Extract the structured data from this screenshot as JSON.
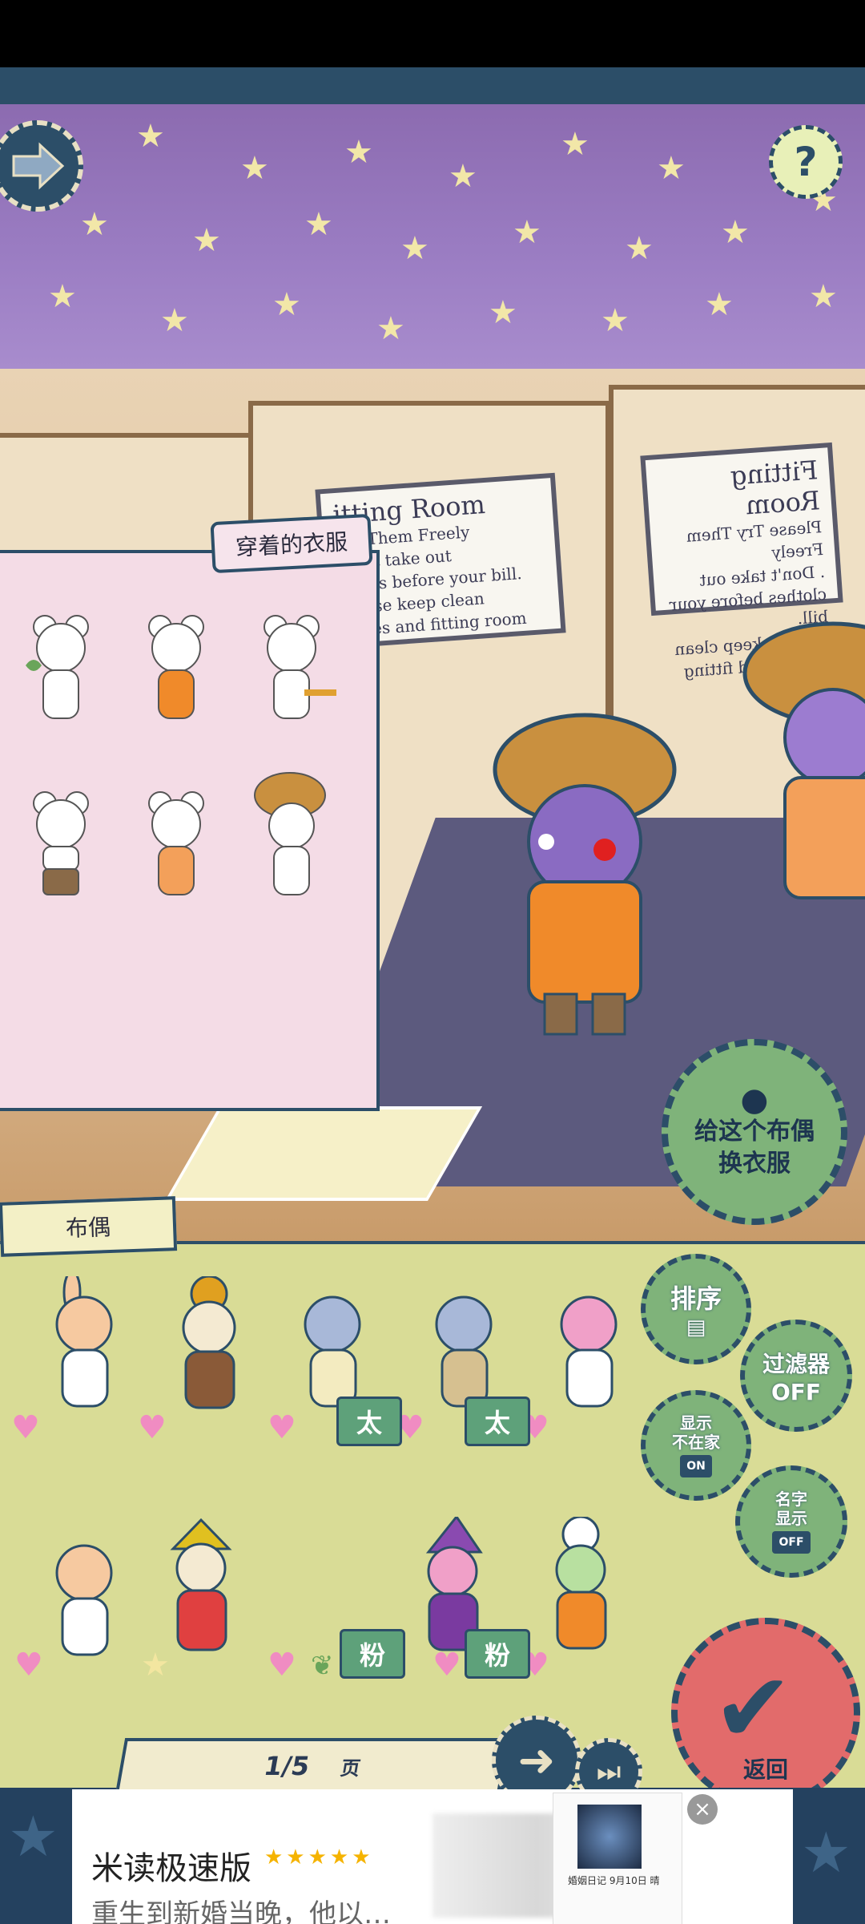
{
  "status_bar": {},
  "top": {
    "help_label": "?"
  },
  "worn_clothes": {
    "tab_label": "穿着的衣服"
  },
  "fitting_room_sign_left": {
    "line1": "itting Room",
    "line2": "Try Them Freely",
    "line3": "Don't take out",
    "line4": "lothes before your bill.",
    "line5": "Please keep clean",
    "line6": "lothes and fitting room"
  },
  "fitting_room_sign_right": {
    "line1": "Fitting Room",
    "line2": "Please Try Them Freely",
    "line3": ". Don't take out",
    "line4": "clothes before your bill.",
    "line5": ". Please keep clean",
    "line6": "clothes and fitting room"
  },
  "change_clothes_button": {
    "label_line1": "给这个布偶",
    "label_line2": "换衣服"
  },
  "dolls": {
    "tab_label": "布偶",
    "tags": [
      "太",
      "太",
      "粉",
      "粉"
    ]
  },
  "side_buttons": {
    "sort": "排序",
    "filter": "过滤器",
    "filter_state": "OFF",
    "show_absent": "显示\n不在家",
    "show_absent_state": "ON",
    "show_name": "名字\n显示",
    "show_name_state": "OFF"
  },
  "confirm_button": {
    "label": "返回"
  },
  "pagination": {
    "current": "1/5",
    "unit": "页"
  },
  "ad": {
    "title": "米读极速版",
    "stars": "★★★★★",
    "subtitle": "重生到新婚当晚，他以…",
    "book_title": "婚姻日记 9月10日 晴"
  },
  "colors": {
    "sky": "#9a7cc2",
    "navy": "#2c4e68",
    "panel_pink": "#f4dce6",
    "doll_panel": "#d9dc96",
    "confirm_red": "#e26b6b",
    "button_green": "#7fb37a"
  }
}
